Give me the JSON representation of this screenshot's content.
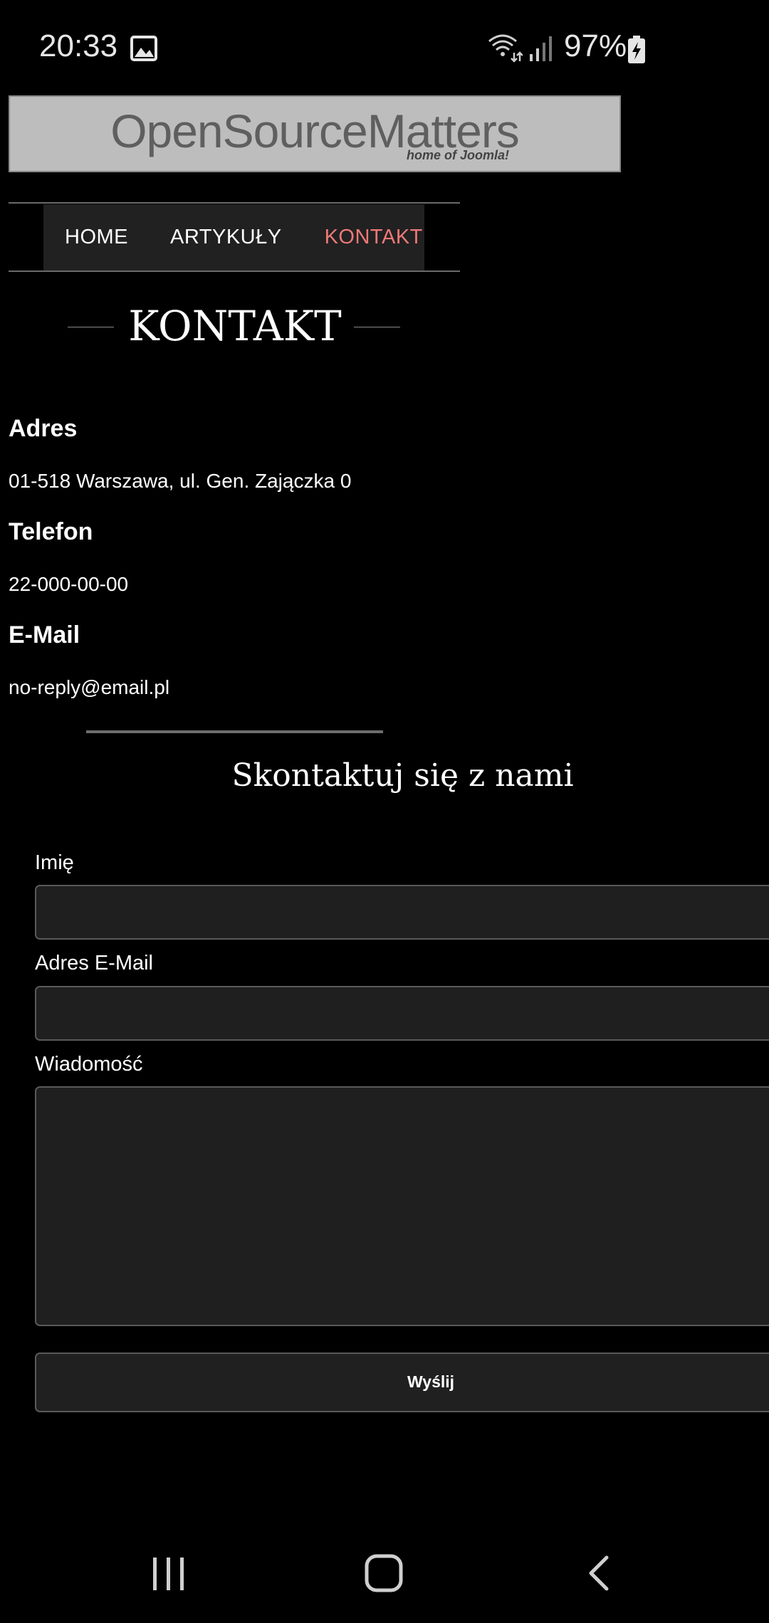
{
  "status_bar": {
    "time": "20:33",
    "battery": "97%",
    "icons": [
      "photo-icon",
      "wifi-icon",
      "signal-icon",
      "battery-charging-icon"
    ]
  },
  "logo": {
    "main": "OpenSourceMatters",
    "sub": "home of Joomla!"
  },
  "nav": {
    "items": [
      {
        "label": "HOME",
        "active": false
      },
      {
        "label": "ARTYKUŁY",
        "active": false
      },
      {
        "label": "KONTAKT",
        "active": true
      }
    ],
    "active_color": "#f07878"
  },
  "page": {
    "title": "KONTAKT"
  },
  "contact": {
    "address_label": "Adres",
    "address": "01-518 Warszawa, ul. Gen. Zajączka 0",
    "phone_label": "Telefon",
    "phone": "22-000-00-00",
    "email_label": "E-Mail",
    "email": "no-reply@email.pl"
  },
  "form": {
    "title": "Skontaktuj się z nami",
    "name_label": "Imię",
    "name_value": "",
    "email_label": "Adres E-Mail",
    "email_value": "",
    "message_label": "Wiadomość",
    "message_value": "",
    "submit_label": "Wyślij"
  },
  "system_nav": {
    "icons": [
      "recent-apps-icon",
      "home-icon",
      "back-icon"
    ]
  }
}
